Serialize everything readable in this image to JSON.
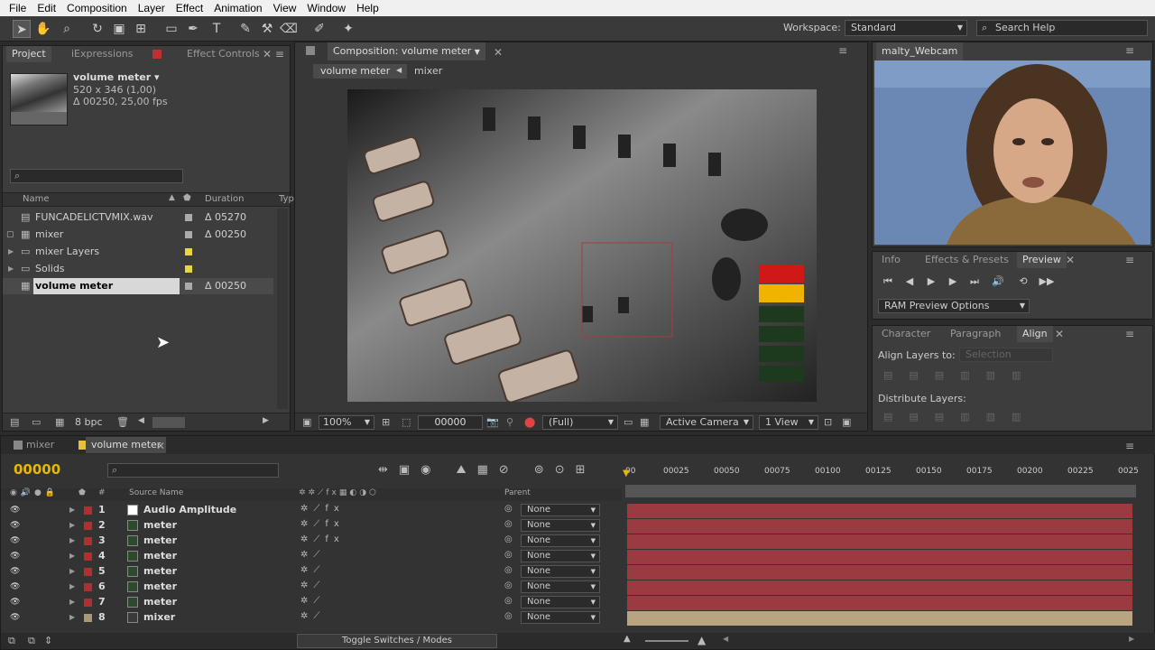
{
  "menu": [
    "File",
    "Edit",
    "Composition",
    "Layer",
    "Effect",
    "Animation",
    "View",
    "Window",
    "Help"
  ],
  "workspace": {
    "label": "Workspace:",
    "value": "Standard",
    "search": "Search Help"
  },
  "project": {
    "tabs": [
      "Project",
      "iExpressions",
      "Effect Controls"
    ],
    "item_name": "volume meter ▾",
    "item_size": "520 x 346 (1,00)",
    "item_duration": "Δ 00250, 25,00 fps",
    "col_name": "Name",
    "col_duration": "Duration",
    "col_type": "Typ",
    "items": [
      {
        "name": "FUNCADELICTVMIX.wav",
        "dur": "Δ 05270"
      },
      {
        "name": "mixer",
        "dur": "Δ 00250"
      },
      {
        "name": "mixer Layers",
        "dur": ""
      },
      {
        "name": "Solids",
        "dur": ""
      },
      {
        "name": "volume meter",
        "dur": "Δ 00250"
      }
    ],
    "bpc": "8 bpc"
  },
  "comp": {
    "tab": "Composition: volume meter",
    "crumbs": [
      "volume meter",
      "mixer"
    ],
    "zoom": "100%",
    "timecode": "00000",
    "quality": "(Full)",
    "camera": "Active Camera",
    "view": "1 View"
  },
  "webcam": {
    "tab": "malty_Webcam"
  },
  "preview": {
    "tabs": [
      "Info",
      "Effects & Presets",
      "Preview"
    ],
    "ram": "RAM Preview Options"
  },
  "align": {
    "tabs": [
      "Character",
      "Paragraph",
      "Align"
    ],
    "align_to": "Align Layers to:",
    "selection": "Selection",
    "distribute": "Distribute Layers:"
  },
  "timeline": {
    "tabs": [
      "mixer",
      "volume meter"
    ],
    "timecode": "00000",
    "col_source": "Source Name",
    "col_hash": "#",
    "col_parent": "Parent",
    "ruler": [
      "00",
      "00025",
      "00050",
      "00075",
      "00100",
      "00125",
      "00150",
      "00175",
      "00200",
      "00225",
      "0025"
    ],
    "layers": [
      {
        "num": "1",
        "name": "Audio Amplitude",
        "parent": "None",
        "fx": true
      },
      {
        "num": "2",
        "name": "meter",
        "parent": "None",
        "fx": true
      },
      {
        "num": "3",
        "name": "meter",
        "parent": "None",
        "fx": true
      },
      {
        "num": "4",
        "name": "meter",
        "parent": "None",
        "fx": false
      },
      {
        "num": "5",
        "name": "meter",
        "parent": "None",
        "fx": false
      },
      {
        "num": "6",
        "name": "meter",
        "parent": "None",
        "fx": false
      },
      {
        "num": "7",
        "name": "meter",
        "parent": "None",
        "fx": false
      },
      {
        "num": "8",
        "name": "mixer",
        "parent": "None",
        "fx": false
      }
    ],
    "toggle": "Toggle Switches / Modes"
  }
}
